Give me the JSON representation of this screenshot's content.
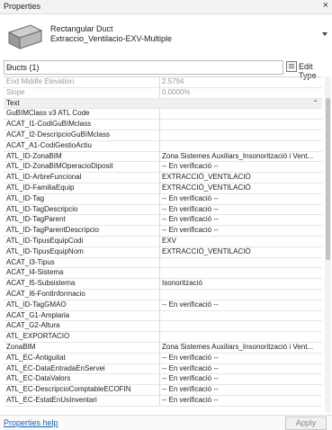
{
  "window": {
    "title": "Properties",
    "close_glyph": "×"
  },
  "type_selector": {
    "family": "Rectangular Duct",
    "type": "Extraccio_Ventilacio-EXV-Multiple"
  },
  "filter": {
    "selected": "Ducts (1)",
    "edit_type_label": "Edit Type"
  },
  "rows": [
    {
      "name": "End Middle Elevation",
      "value": "2.5794",
      "kind": "ro"
    },
    {
      "name": "Slope",
      "value": "0.0000%",
      "kind": "ro"
    },
    {
      "name": "Text",
      "value": "",
      "kind": "grp",
      "caret": "⌃"
    },
    {
      "name": "GuBIMClass v3 ATL Code",
      "value": ""
    },
    {
      "name": "ACAT_I1-CodiGuBIMclass",
      "value": ""
    },
    {
      "name": "ACAT_I2-DescripcioGuBIMclass",
      "value": ""
    },
    {
      "name": "ACAT_A1-CodiGestioActiu",
      "value": ""
    },
    {
      "name": "ATL_ID-ZonaBIM",
      "value": "Zona Sistemes Auxiliars_Insonorització i Vent..."
    },
    {
      "name": "ATL_ID-ZonaBIMOperacioDiposit",
      "value": "-- En verificació --"
    },
    {
      "name": "ATL_ID-ArbreFuncional",
      "value": "EXTRACCIÓ_VENTILACIÓ"
    },
    {
      "name": "ATL_ID-FamiliaEquip",
      "value": "EXTRACCIÓ_VENTILACIÓ"
    },
    {
      "name": "ATL_ID-Tag",
      "value": "-- En verificació --"
    },
    {
      "name": "ATL_ID-TagDescripcio",
      "value": "-- En verificació --"
    },
    {
      "name": "ATL_ID-TagParent",
      "value": "-- En verificació --"
    },
    {
      "name": "ATL_ID-TagParentDescripcio",
      "value": "-- En verificació --"
    },
    {
      "name": "ATL_ID-TipusEquipCodi",
      "value": "EXV"
    },
    {
      "name": "ATL_ID-TipusEquipNom",
      "value": "EXTRACCIÓ_VENTILACIÓ"
    },
    {
      "name": "ACAT_I3-Tipus",
      "value": ""
    },
    {
      "name": "ACAT_I4-Sistema",
      "value": ""
    },
    {
      "name": "ACAT_I5-Subsistema",
      "value": "Isonorització"
    },
    {
      "name": "ACAT_I6-FontInformacio",
      "value": ""
    },
    {
      "name": "ATL_ID-TagGMAO",
      "value": "-- En verificació --"
    },
    {
      "name": "ACAT_G1-Amplaria",
      "value": ""
    },
    {
      "name": "ACAT_G2-Altura",
      "value": ""
    },
    {
      "name": "ATL_EXPORTACIO",
      "value": ""
    },
    {
      "name": "ZonaBIM",
      "value": "Zona Sistemes Auxiliars_Insonorització i Vent..."
    },
    {
      "name": "ATL_EC-Antiguitat",
      "value": "-- En verificació --"
    },
    {
      "name": "ATL_EC-DataEntradaEnServei",
      "value": "-- En verificació --"
    },
    {
      "name": "ATL_EC-DataValors",
      "value": "-- En verificació --"
    },
    {
      "name": "ATL_EC-DescripcioComptableECOFIN",
      "value": "-- En verificació --"
    },
    {
      "name": "ATL_EC-EstatEnUsInventari",
      "value": "-- En verificació --"
    }
  ],
  "footer": {
    "help_label": "Properties help",
    "apply_label": "Apply"
  }
}
